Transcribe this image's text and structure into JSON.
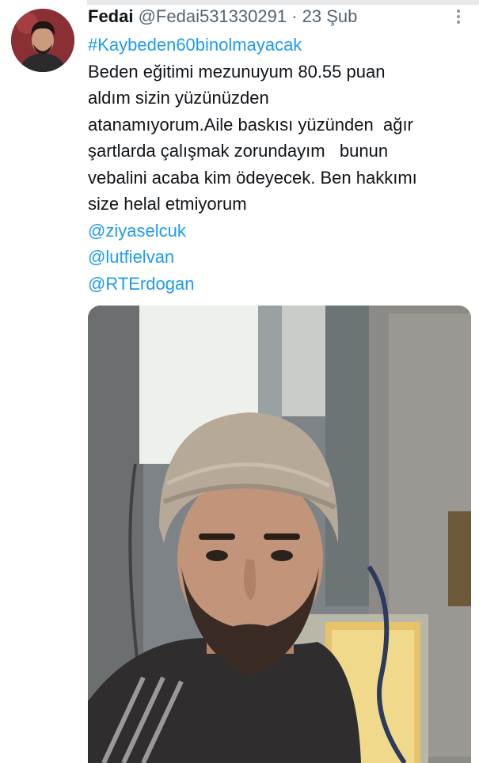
{
  "tweet": {
    "author_name": "Fedai",
    "author_handle": "@Fedai531330291",
    "separator": "·",
    "date": "23 Şub",
    "hashtag": "#Kaybeden60binolmayacak",
    "text_lines": [
      "Beden eğitimi mezunuyum 80.55 puan",
      "aldım sizin yüzünüzden",
      "atanamıyorum.Aile baskısı yüzünden  ağır",
      "şartlarda çalışmak zorundayım   bunun",
      "vebalini acaba kim ödeyecek. Ben hakkımı",
      "size helal etmiyorum"
    ],
    "mentions": [
      "@ziyaselcuk",
      "@lutfielvan",
      "@RTErdogan"
    ],
    "more_icon": "more-horizontal-icon"
  },
  "colors": {
    "link": "#1d9bf0",
    "text": "#0f1419",
    "secondary": "#536471"
  }
}
